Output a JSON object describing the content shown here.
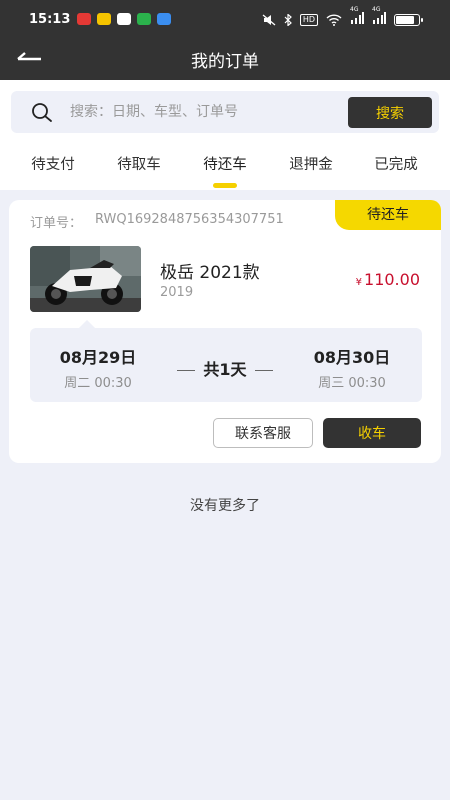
{
  "status_bar": {
    "time": "15:13",
    "apps": [
      "app-red-icon",
      "app-meituan-icon",
      "app-chat-icon",
      "app-message-icon",
      "app-blue-icon"
    ],
    "hd_label": "HD",
    "signal_labels": [
      "4G",
      "4G"
    ],
    "battery_level": 0.85
  },
  "header": {
    "title": "我的订单",
    "back_icon": "back-arrow-icon"
  },
  "search": {
    "placeholder": "搜索：日期、车型、订单号",
    "button_label": "搜索"
  },
  "tabs": [
    {
      "label": "待支付",
      "active": false
    },
    {
      "label": "待取车",
      "active": false
    },
    {
      "label": "待还车",
      "active": true
    },
    {
      "label": "退押金",
      "active": false
    },
    {
      "label": "已完成",
      "active": false
    }
  ],
  "order": {
    "number_label": "订单号：",
    "number": "RWQ1692848756354307751",
    "status": "待还车",
    "model_name": "极岳 2021款",
    "model_year": "2019",
    "price_symbol": "¥",
    "price": "110.00",
    "start_date": "08月29日",
    "start_time": "周二 00:30",
    "duration": "共1天",
    "end_date": "08月30日",
    "end_time": "周三 00:30",
    "contact_button": "联系客服",
    "return_button": "收车"
  },
  "footer_text": "没有更多了",
  "colors": {
    "header_bg": "#333333",
    "accent_yellow": "#f5d000",
    "price_red": "#c8102e",
    "page_bg": "#eef0f8"
  }
}
